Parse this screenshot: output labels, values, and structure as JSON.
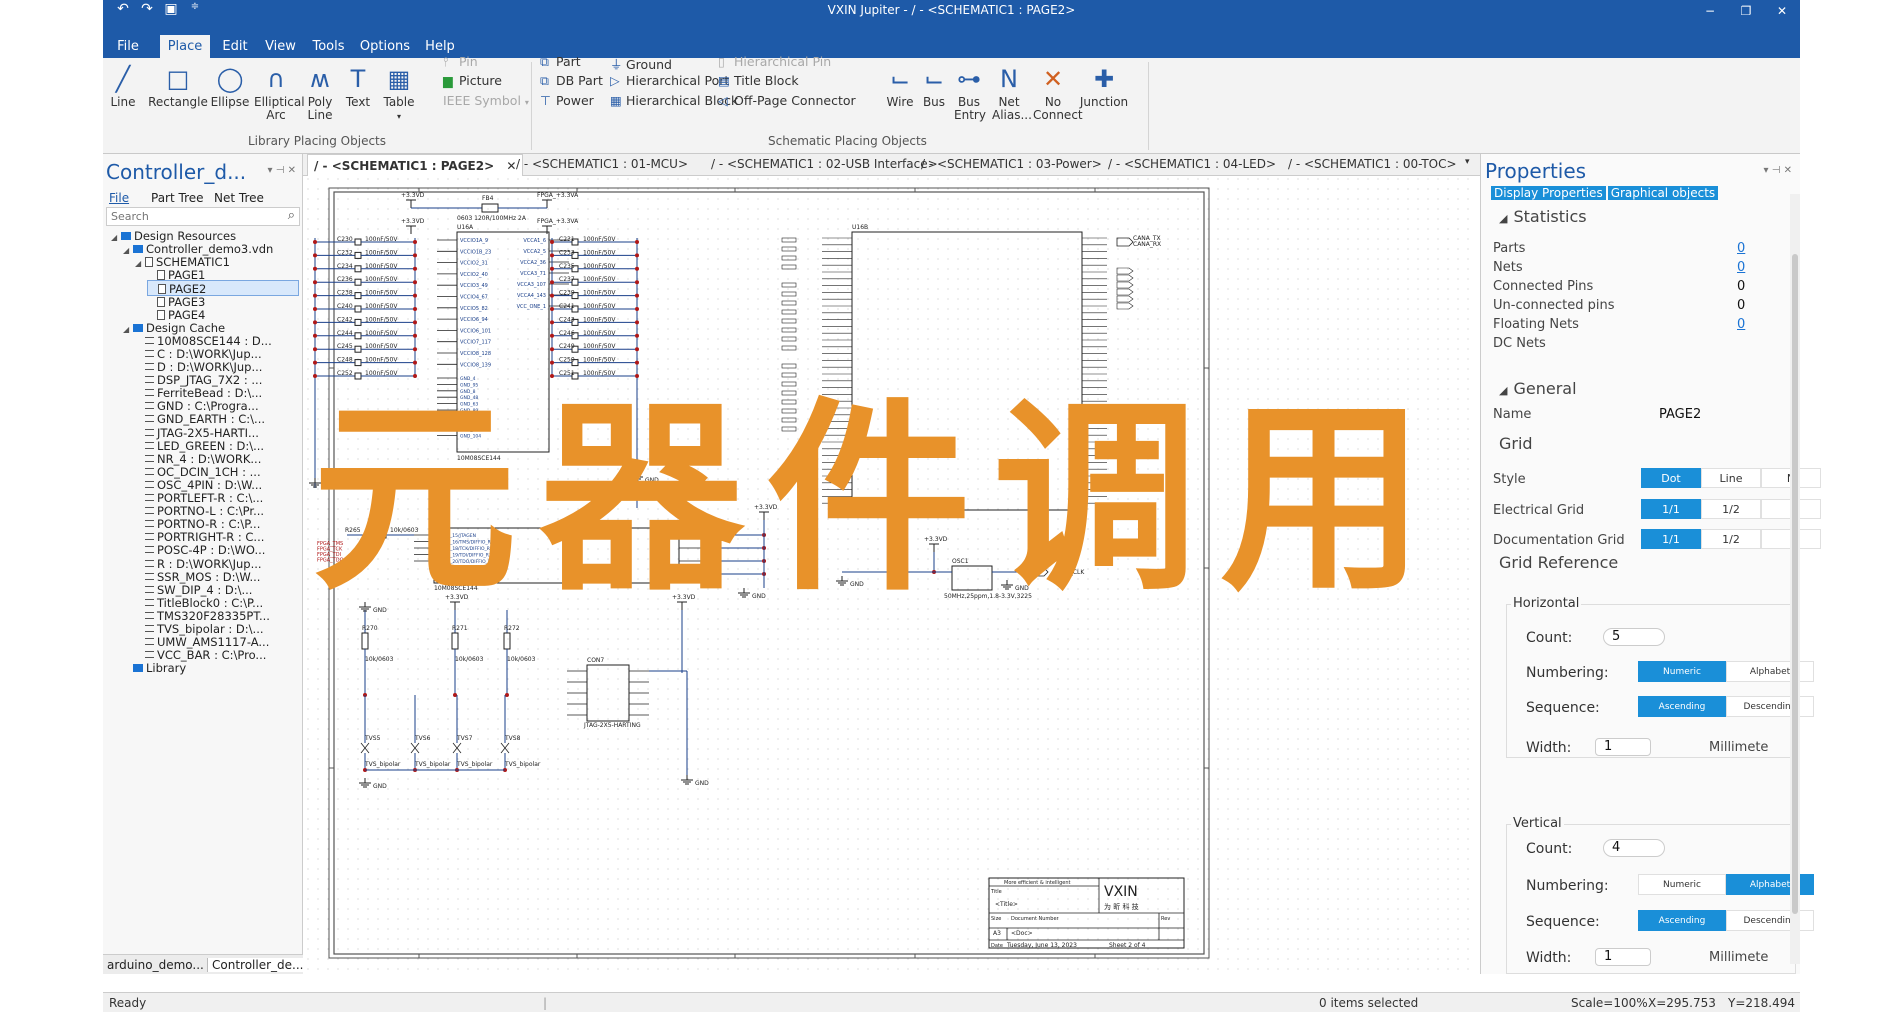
{
  "window": {
    "title": "VXIN Jupiter - / - <SCHEMATIC1 : PAGE2>",
    "quick_access": [
      "undo-icon",
      "redo-icon",
      "save-icon",
      "customize-icon"
    ],
    "controls": {
      "minimize": "−",
      "restore": "❐",
      "close": "✕"
    }
  },
  "menu": {
    "items": [
      "File",
      "Place",
      "Edit",
      "View",
      "Tools",
      "Options",
      "Help"
    ],
    "active": "Place"
  },
  "ribbon": {
    "library_group": {
      "label": "Library Placing Objects",
      "big": [
        "Line",
        "Rectangle",
        "Ellipse",
        "Elliptical Arc",
        "Poly Line",
        "Text",
        "Table"
      ],
      "small": [
        "Pin",
        "Picture",
        "IEEE Symbol"
      ]
    },
    "schematic_group": {
      "label": "Schematic Placing Objects",
      "col1": [
        "Part",
        "DB Part",
        "Power"
      ],
      "col2": [
        "Ground",
        "Hierarchical Port",
        "Hierarchical Block"
      ],
      "col3": [
        "Hierarchical Pin",
        "Title Block",
        "Off-Page Connector"
      ],
      "big": [
        "Wire",
        "Bus",
        "Bus Entry",
        "Net Alias...",
        "No Connect",
        "Junction"
      ]
    }
  },
  "left_panel": {
    "title": "Controller_d...",
    "tabs": [
      "File",
      "Part Tree",
      "Net Tree"
    ],
    "search_placeholder": "Search",
    "tree": [
      {
        "label": "Design Resources",
        "level": 0,
        "type": "folder"
      },
      {
        "label": "Controller_demo3.vdn",
        "level": 1,
        "type": "folder"
      },
      {
        "label": "SCHEMATIC1",
        "level": 2,
        "type": "page"
      },
      {
        "label": "PAGE1",
        "level": 3,
        "type": "page"
      },
      {
        "label": "PAGE2",
        "level": 3,
        "type": "page",
        "selected": true
      },
      {
        "label": "PAGE3",
        "level": 3,
        "type": "page"
      },
      {
        "label": "PAGE4",
        "level": 3,
        "type": "page"
      },
      {
        "label": "Design Cache",
        "level": 1,
        "type": "folder"
      },
      {
        "label": "10M08SCE144 : D...",
        "level": 2,
        "type": "comp"
      },
      {
        "label": "C : D:\\WORK\\Jup...",
        "level": 2,
        "type": "comp"
      },
      {
        "label": "D : D:\\WORK\\Jup...",
        "level": 2,
        "type": "comp"
      },
      {
        "label": "DSP_JTAG_7X2 : ...",
        "level": 2,
        "type": "comp"
      },
      {
        "label": "FerriteBead : D:\\...",
        "level": 2,
        "type": "comp"
      },
      {
        "label": "GND : C:\\Progra...",
        "level": 2,
        "type": "comp"
      },
      {
        "label": "GND_EARTH : C:\\...",
        "level": 2,
        "type": "comp"
      },
      {
        "label": "JTAG-2X5-HARTI...",
        "level": 2,
        "type": "comp"
      },
      {
        "label": "LED_GREEN : D:\\...",
        "level": 2,
        "type": "comp"
      },
      {
        "label": "NR_4 : D:\\WORK...",
        "level": 2,
        "type": "comp"
      },
      {
        "label": "OC_DCIN_1CH : ...",
        "level": 2,
        "type": "comp"
      },
      {
        "label": "OSC_4PIN : D:\\W...",
        "level": 2,
        "type": "comp"
      },
      {
        "label": "PORTLEFT-R : C:\\...",
        "level": 2,
        "type": "comp"
      },
      {
        "label": "PORTNO-L : C:\\Pr...",
        "level": 2,
        "type": "comp"
      },
      {
        "label": "PORTNO-R : C:\\P...",
        "level": 2,
        "type": "comp"
      },
      {
        "label": "PORTRIGHT-R : C...",
        "level": 2,
        "type": "comp"
      },
      {
        "label": "POSC-4P : D:\\WO...",
        "level": 2,
        "type": "comp"
      },
      {
        "label": "R : D:\\WORK\\Jup...",
        "level": 2,
        "type": "comp"
      },
      {
        "label": "SSR_MOS : D:\\W...",
        "level": 2,
        "type": "comp"
      },
      {
        "label": "SW_DIP_4 : D:\\...",
        "level": 2,
        "type": "comp"
      },
      {
        "label": "TitleBlock0 : C:\\P...",
        "level": 2,
        "type": "comp"
      },
      {
        "label": "TMS320F28335PT...",
        "level": 2,
        "type": "comp"
      },
      {
        "label": "TVS_bipolar : D:\\...",
        "level": 2,
        "type": "comp"
      },
      {
        "label": "UMW_AMS1117-A...",
        "level": 2,
        "type": "comp"
      },
      {
        "label": "VCC_BAR : C:\\Pro...",
        "level": 2,
        "type": "comp"
      },
      {
        "label": "Library",
        "level": 1,
        "type": "folder"
      }
    ],
    "bottom_tabs": [
      "arduino_demo...",
      "Controller_de..."
    ]
  },
  "doc_tabs": [
    "/ - <SCHEMATIC1 : PAGE2>",
    "/ - <SCHEMATIC1 : 01-MCU>",
    "/ - <SCHEMATIC1 : 02-USB Interface>",
    "/ - <SCHEMATIC1 : 03-Power>",
    "/ - <SCHEMATIC1 : 04-LED>",
    "/ - <SCHEMATIC1 : 00-TOC>"
  ],
  "schematic": {
    "u16a": {
      "ref": "U16A",
      "part": "10M08SCE144",
      "left_pins": [
        "VCCIO1A_9",
        "VCCIO1B_23",
        "VCCIO2_31",
        "VCCIO2_40",
        "VCCIO3_49",
        "VCCIO4_67",
        "VCCIO5_82",
        "VCCIO6_94",
        "VCCIO6_101",
        "VCCIO7_117",
        "VCCIO8_128",
        "VCCIO8_139"
      ],
      "right_pins": [
        "VCCA1_6",
        "VCCA2_5",
        "VCCA2_36",
        "VCCA3_71",
        "VCCA3_107",
        "VCCA4_143",
        "VCC_ONE_1"
      ],
      "gnd_pins": [
        "GND_4",
        "GND_95",
        "GND_8",
        "GND_48",
        "GND_63",
        "GND_89",
        "GND_114",
        "GND_123",
        "GND_136",
        "GND_104"
      ]
    },
    "caps_left": [
      "C230",
      "C232",
      "C234",
      "C236",
      "C238",
      "C240",
      "C242",
      "C244",
      "C245",
      "C248",
      "C252"
    ],
    "caps_right": [
      "C231",
      "C233",
      "C235",
      "C237",
      "C239",
      "C241",
      "C243",
      "C246",
      "C249",
      "C250",
      "C251"
    ],
    "cap_value": "100nF/50V",
    "u16c": {
      "ref": "U16C",
      "part": "10M08SCE144",
      "pins": [
        "IO_1A_15/JTAGEN",
        "IO_1B_16/TMS/DIFFIO_RX_L11N",
        "IO_1B_18/TCK/DIFFIO_RX_L11P",
        "IO_1B_19/TDI/DIFFIO_RX_L12N",
        "IO_1B_20/TDO/DIFFIO_RX_L12P"
      ]
    },
    "u16b": {
      "ref": "U16B",
      "part": "10M08SCE144"
    },
    "osc": {
      "ref": "OSC1",
      "value": "50MHz,25ppm,1.8-3.3V,3225"
    },
    "jtag": {
      "ref": "CON7",
      "part": "JTAG-2X5-HARTING"
    },
    "tvs": [
      "TVS5",
      "TVS6",
      "TVS7",
      "TVS8"
    ],
    "tvs_value": "TVS_bipolar",
    "resistors": [
      {
        "ref": "R270",
        "value": "10k/0603"
      },
      {
        "ref": "R271",
        "value": "10k/0603"
      },
      {
        "ref": "R272",
        "value": "10k/0603"
      }
    ],
    "power": [
      "+3.3VD",
      "FPGA_+3.3VA",
      "GND"
    ],
    "ferrite": {
      "ref": "FB4",
      "value": "0603 120R/100MHz 2A"
    },
    "nets": [
      "CANA_TX",
      "CANA_RX",
      "FPGA_CLK",
      "FPGA_TMS",
      "FPGA_TCK",
      "FPGA_TDI",
      "FPGA_TDO"
    ],
    "title_block": {
      "tagline": "More efficient & intelligent",
      "brand": "VXIN",
      "brand_cn": "为 昕 科 技",
      "title_label": "Title",
      "title": "<Title>",
      "size_label": "Size",
      "size": "A3",
      "docnum_label": "Document Number",
      "docnum": "<Doc>",
      "rev_label": "Rev",
      "date_label": "Date",
      "date": "Tuesday, June 13, 2023",
      "sheet": "Sheet 2 of 4"
    }
  },
  "overlay_text": "元器件调用",
  "properties": {
    "title": "Properties",
    "tabs": [
      "Display Properties",
      "Graphical objects"
    ],
    "statistics": {
      "title": "Statistics",
      "rows": [
        {
          "label": "Parts",
          "value": "0",
          "link": true
        },
        {
          "label": "Nets",
          "value": "0",
          "link": true
        },
        {
          "label": "Connected Pins",
          "value": "0",
          "link": false
        },
        {
          "label": "Un-connected pins",
          "value": "0",
          "link": false
        },
        {
          "label": "Floating Nets",
          "value": "0",
          "link": true
        },
        {
          "label": "DC Nets",
          "value": "",
          "link": false
        }
      ]
    },
    "general": {
      "title": "General",
      "name_label": "Name",
      "name_value": "PAGE2"
    },
    "grid": {
      "title": "Grid",
      "style_label": "Style",
      "style_options": [
        "Dot",
        "Line",
        "N"
      ],
      "electrical_label": "Electrical Grid",
      "documentation_label": "Documentation Grid",
      "grid_options": [
        "1/1",
        "1/2"
      ]
    },
    "grid_reference": {
      "title": "Grid Reference",
      "horizontal": {
        "label": "Horizontal",
        "count": "5",
        "numbering": [
          "Numeric",
          "Alphabet"
        ],
        "numbering_on": 0,
        "sequence": [
          "Ascending",
          "Descending"
        ],
        "sequence_on": 0,
        "width": "1",
        "unit": "Millimete"
      },
      "vertical": {
        "label": "Vertical",
        "count": "4",
        "numbering": [
          "Numeric",
          "Alphabet"
        ],
        "numbering_on": 1,
        "sequence": [
          "Ascending",
          "Descending"
        ],
        "sequence_on": 0,
        "width": "1",
        "unit": "Millimete"
      }
    }
  },
  "status": {
    "left": "Ready",
    "middle": "0 items selected",
    "scale": "Scale=100%",
    "x": "X=295.753",
    "y": "Y=218.494"
  },
  "colors": {
    "accent": "#1e5aa8",
    "wire": "#1a3f8a",
    "junction": "#b01818",
    "overlay": "#e8922a"
  }
}
